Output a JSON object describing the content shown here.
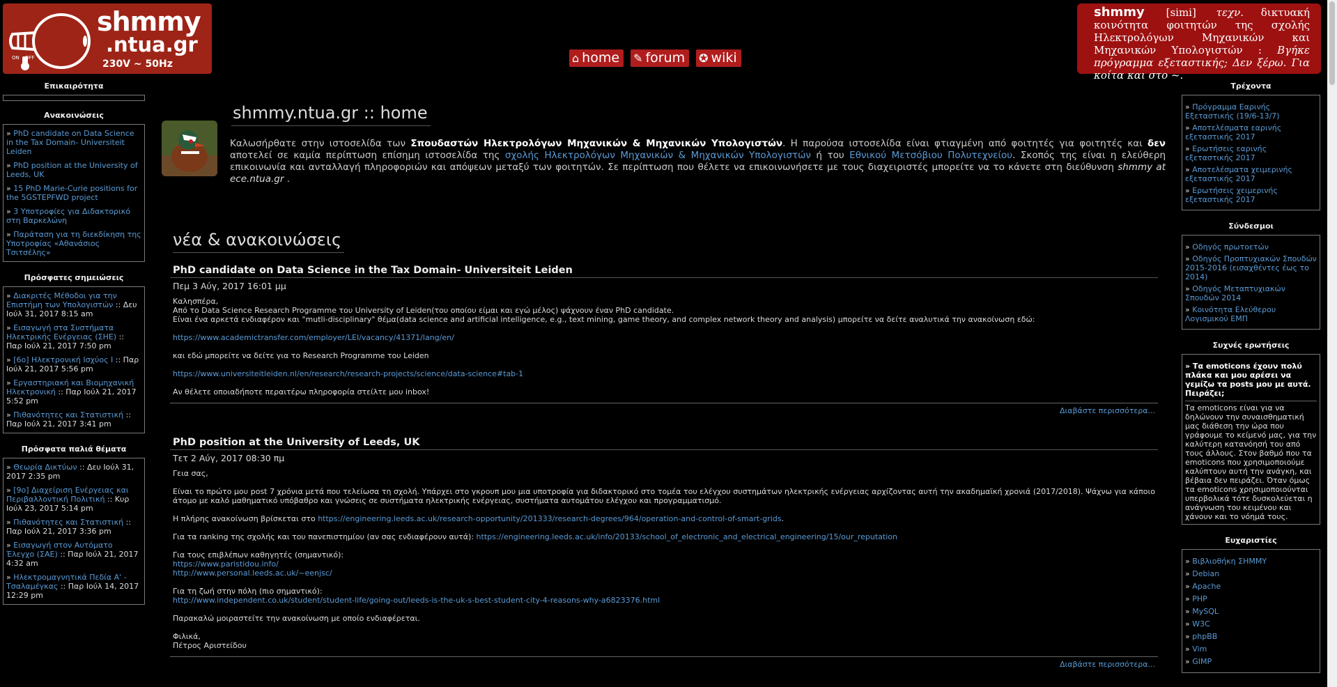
{
  "header": {
    "logo_title": "shmmy",
    "logo_sub": ".ntua.gr",
    "logo_voltage": "230V ~ 50Hz",
    "switch_on": "ON",
    "switch_off": "OFF",
    "nav": [
      {
        "label": "home",
        "icon": "home-icon"
      },
      {
        "label": "forum",
        "icon": "forum-icon"
      },
      {
        "label": "wiki",
        "icon": "wiki-icon"
      }
    ],
    "definition": {
      "word": "shmmy",
      "phonetic": "[simi]",
      "abbr": "τεχν.",
      "text": "δικτυακή κοινότητα φοιτητών της σχολής Ηλεκτρολόγων Μηχανικών και Μηχανικών Υπολογιστών :",
      "joke": "Βγήκε πρόγραμμα εξεταστικής; Δεν ξέρω. Για κοίτα και στο ~."
    }
  },
  "left": {
    "epikairotita_title": "Επικαιρότητα",
    "announcements_title": "Ανακοινώσεις",
    "announcements": [
      "PhD candidate on Data Science in the Tax Domain- Universiteit Leiden",
      "PhD position at the University of Leeds, UK",
      "15 PhD Marie-Curie positions for the 5GSTEPFWD project",
      "3 Υποτροφίες για Διδακτορικό στη Βαρκελώνη",
      "Παράταση για τη διεκδίκηση της Υποτροφίας «Αθανάσιος Τσιτσέλης»"
    ],
    "notes_title": "Πρόσφατες σημειώσεις",
    "notes": [
      {
        "link": "Διακριτές Μέθοδοι για την Επιστήμη των Υπολογιστών",
        "meta": " :: Δευ Ιούλ 31, 2017 8:15 am"
      },
      {
        "link": "Εισαγωγή στα Συστήματα Ηλεκτρικής Ενέργειας (ΣΗΕ)",
        "meta": " :: Παρ Ιούλ 21, 2017 7:50 pm"
      },
      {
        "link": "[6ο] Ηλεκτρονική Ισχύος Ι",
        "meta": " :: Παρ Ιούλ 21, 2017 5:56 pm"
      },
      {
        "link": "Εργαστηριακή και Βιομηχανική Ηλεκτρονική",
        "meta": " :: Παρ Ιούλ 21, 2017 5:52 pm"
      },
      {
        "link": "Πιθανότητες και Στατιστική",
        "meta": " :: Παρ Ιούλ 21, 2017 3:41 pm"
      }
    ],
    "old_title": "Πρόσφατα παλιά θέματα",
    "old_topics": [
      {
        "link": "Θεωρία Δικτύων",
        "meta": " :: Δευ Ιούλ 31, 2017 2:35 pm"
      },
      {
        "link": "[9ο] Διαχείριση Ενέργειας και Περιβαλλοντική Πολιτική",
        "meta": " :: Κυρ Ιούλ 23, 2017 5:14 pm"
      },
      {
        "link": "Πιθανότητες και Στατιστική",
        "meta": " :: Παρ Ιούλ 21, 2017 3:36 pm"
      },
      {
        "link": "Εισαγωγή στον Αυτόματο Έλεγχο (ΣΑΕ)",
        "meta": " :: Παρ Ιούλ 21, 2017 4:32 am"
      },
      {
        "link": "Ηλεκτρομαγνητικά Πεδία Α' - Τσαλαμέγκας",
        "meta": " :: Παρ Ιούλ 14, 2017 12:29 pm"
      }
    ]
  },
  "right": {
    "current_title": "Τρέχοντα",
    "current": [
      "Πρόγραμμα Εαρινής Εξεταστικής (19/6-13/7)",
      "Αποτελέσματα εαρινής εξεταστικής 2017",
      "Ερωτήσεις εαρινής εξεταστικής 2017",
      "Αποτελέσματα χειμερινής εξεταστικής 2017",
      "Ερωτήσεις χειμερινής εξεταστικής 2017"
    ],
    "links_title": "Σύνδεσμοι",
    "links": [
      "Οδηγός πρωτοετών",
      " Οδηγός Προπτυχιακών Σπουδών 2015-2016 (εισαχθέντες έως το 2014)",
      "Οδηγός Μεταπτυχιακών Σπουδών 2014",
      "Κοινότητα Ελεύθερου Λογισμικού ΕΜΠ"
    ],
    "faq_title": "Συχνές ερωτήσεις",
    "faq_q": "» Τα emoticons έχουν πολύ πλάκα και μου αρέσει να γεμίζω τα posts μου με αυτά. Πειράζει;",
    "faq_a": "Τα emoticons είναι για να δηλώνουν την συναισθηματική μας διάθεση την ώρα που γράφουμε το κείμενό μας, για την καλύτερη κατανόησή του από τους άλλους. Στον βαθμό που τα emoticons που χρησιμοποιούμε καλύπτουν αυτή την ανάγκη, και βέβαια δεν πειράζει. Όταν όμως τα emoticons χρησιμοποιούνται υπερβολικά τότε δυσκολεύεται η ανάγνωση του κειμένου και χάνουν και το νόημά τους.",
    "thanks_title": "Ευχαριστίες",
    "thanks": [
      "Βιβλιοθήκη ΣΗΜΜΥ",
      "Debian",
      "Apache",
      "PHP",
      "MySQL",
      "W3C",
      "phpBB",
      "Vim",
      "GIMP"
    ]
  },
  "main": {
    "site_title": "shmmy.ntua.gr :: home",
    "welcome_1": "Καλωσήρθατε στην ιστοσελίδα των ",
    "welcome_b1": "Σπουδαστών Ηλεκτρολόγων Μηχανικών & Μηχανικών Υπολογιστών",
    "welcome_2": ". Η παρούσα ιστοσελίδα είναι φτιαγμένη από φοιτητές για φοιτητές και ",
    "welcome_b2": "δεν",
    "welcome_3": " αποτελεί σε καμία περίπτωση επίσημη ιστοσελίδα της ",
    "welcome_link1": "σχολής Ηλεκτρολόγων Μηχανικών & Μηχανικών Υπολογιστών",
    "welcome_4": " ή του ",
    "welcome_link2": "Εθνικού Μετσόβιου Πολυτεχνείου",
    "welcome_5": ". Σκοπός της είναι η ελεύθερη επικοινωνία και ανταλλαγή πληροφοριών και απόψεων μεταξύ των φοιτητών. Σε περίπτωση που θέλετε να επικοινωνήσετε με τους διαχειριστές μπορείτε να το κάνετε στη διεύθυνση ",
    "welcome_email": "shmmy at ece.ntua.gr",
    "welcome_6": " .",
    "news_title": "νέα & ανακοινώσεις",
    "read_more": "Διαβάστε περισσότερα...",
    "post1": {
      "title": "PhD candidate on Data Science in the Tax Domain- Universiteit Leiden",
      "date": "Πεμ 3 Αύγ, 2017 16:01 μμ",
      "l1": "Καλησπέρα,",
      "l2": "Από το Data Science Research Programme του University of Leiden(του οποίου είμαι και εγώ μέλος) ψάχνουν έναν PhD candidate.",
      "l3": "Είναι ένα αρκετά ενδιαφέρον και \"mutli-disciplinary\" θέμα(data science and artificial intelligence, e.g., text mining, game theory, and complex network theory and analysis) μπορείτε να δείτε αναλυτικά την ανακοίνωση εδώ:",
      "link1": "https://www.academictransfer.com/employer/LEI/vacancy/41371/lang/en/",
      "l4": "και εδώ μπορείτε να δείτε για το Research Programme του Leiden",
      "link2": "https://www.universiteitleiden.nl/en/research/research-projects/science/data-science#tab-1",
      "l5": "Αν θέλετε οποιαδήποτε περαιτέρω πληροφορία στείλτε μου inbox!"
    },
    "post2": {
      "title": "PhD position at the University of Leeds, UK",
      "date": "Τετ 2 Αύγ, 2017 08:30 πμ",
      "l1": "Γεια σας,",
      "l2": "Είναι το πρώτο μου post 7 χρόνια μετά που τελείωσα τη σχολή. Υπάρχει στο γκρουπ μου μια υποτροφία για διδακτορικό στο τομέα του ελέγχου συστημάτων ηλεκτρικής ενέργειας αρχίζοντας αυτή την ακαδημαϊκή χρονιά (2017/2018). Ψάχνω για κάποιο άτομο με καλό μαθηματικό υπόβαθρο και γνώσεις σε συστήματα ηλεκτρικής ενέργειας, συστήματα αυτομάτου ελέγχου και προγραμματισμό.",
      "l3": "Η πλήρης ανακοίνωση βρίσκεται στο ",
      "link1": "https://engineering.leeds.ac.uk/research-opportunity/201333/research-degrees/964/operation-and-control-of-smart-grids",
      "l3b": ".",
      "l4": "Για τα ranking της σχολής και του πανεπιστημίου (αν σας ενδιαφέρουν αυτά): ",
      "link2": "https://engineering.leeds.ac.uk/info/20133/school_of_electronic_and_electrical_engineering/15/our_reputation",
      "l5": "Για τους επιβλέπων καθηγητές (σημαντικό):",
      "link3": "https://www.paristidou.info/",
      "link4": "http://www.personal.leeds.ac.uk/~eenjsc/",
      "l6": "Για τη ζωή στην πόλη (πιο σημαντικό):",
      "link5": "http://www.independent.co.uk/student/student-life/going-out/leeds-is-the-uk-s-best-student-city-4-reasons-why-a6823376.html",
      "l7": "Παρακαλώ μοιραστείτε την ανακοίνωση με οποίο ενδιαφέρεται.",
      "l8": "Φιλικά,",
      "l9": "Πέτρος Αριστείδου"
    }
  }
}
